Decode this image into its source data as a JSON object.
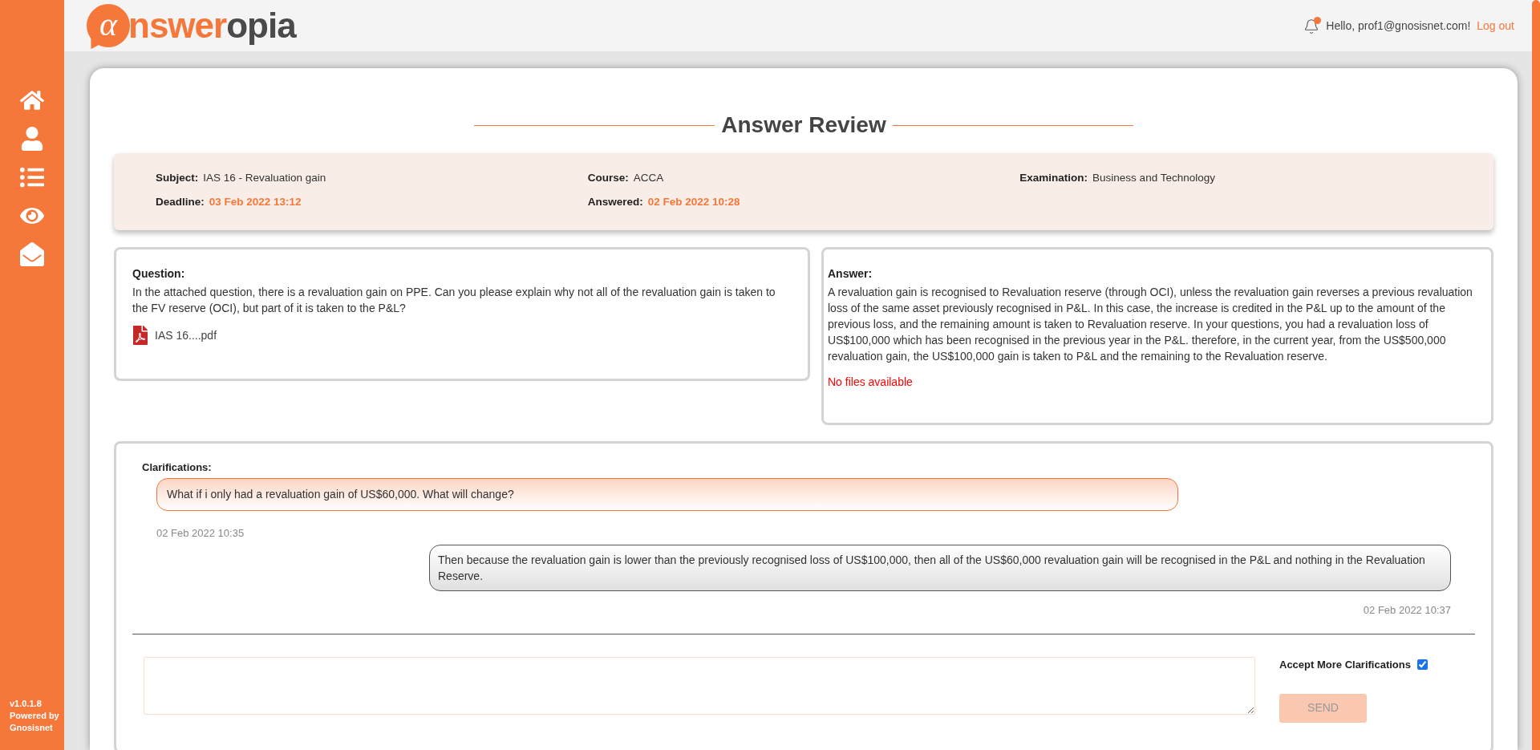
{
  "sidebar": {
    "items": [
      {
        "kind": "home"
      },
      {
        "kind": "user"
      },
      {
        "kind": "list"
      },
      {
        "kind": "eye"
      },
      {
        "kind": "mail"
      }
    ],
    "version": "v1.0.1.8",
    "powered_by": "Powered by Gnosisnet"
  },
  "header": {
    "logo": {
      "mark": "α",
      "first": "nswer",
      "second": "opia"
    },
    "notification": true,
    "greeting": "Hello, prof1@gnosisnet.com!",
    "logout": "Log out"
  },
  "title": "Answer Review",
  "info": [
    {
      "label": "Subject:",
      "value": "IAS 16 - Revaluation gain",
      "highlight": false
    },
    {
      "label": "Course:",
      "value": "ACCA",
      "highlight": false
    },
    {
      "label": "Examination:",
      "value": "Business and Technology",
      "highlight": false
    },
    {
      "label": "Deadline:",
      "value": "03 Feb 2022 13:12",
      "highlight": true
    },
    {
      "label": "Answered:",
      "value": "02 Feb 2022 10:28",
      "highlight": true
    }
  ],
  "question": {
    "label": "Question:",
    "text": "In the attached question, there is a revaluation gain on PPE. Can you please explain why not all of the revaluation gain is taken to the FV reserve (OCI), but part of it is taken to the P&L?",
    "files": [
      {
        "kind": "pdf",
        "name": "IAS 16....pdf"
      }
    ]
  },
  "answer": {
    "label": "Answer:",
    "text": "A revaluation gain is recognised to Revaluation reserve (through OCI), unless the revaluation gain reverses a previous revaluation loss of the same asset previously recognised in P&L. In this case, the increase is credited in the P&L up to the amount of the previous loss, and the remaining amount is taken to Revaluation reserve. In your questions, you had a revaluation loss of US$100,000 which has been recognised in the previous year in the P&L. therefore, in the current year, from the US$500,000 revaluation gain, the US$100,000 gain is taken to P&L and the remaining to the Revaluation reserve.",
    "no_files": "No files available"
  },
  "clarifications": {
    "label": "Clarifications:",
    "messages": [
      {
        "kind": "question",
        "text": "What if i only had a revaluation gain of US$60,000. What will change?",
        "time": "02 Feb 2022 10:35"
      },
      {
        "kind": "reply",
        "text": "Then because the revaluation gain is lower than the previously recognised loss of US$100,000, then all of the US$60,000 revaluation gain will be recognised in the P&L and nothing in the Revaluation Reserve.",
        "time": "02 Feb 2022 10:37"
      }
    ],
    "accept": {
      "label": "Accept More Clarifications",
      "checked": true
    },
    "send": {
      "label": "SEND",
      "disabled": true
    }
  }
}
